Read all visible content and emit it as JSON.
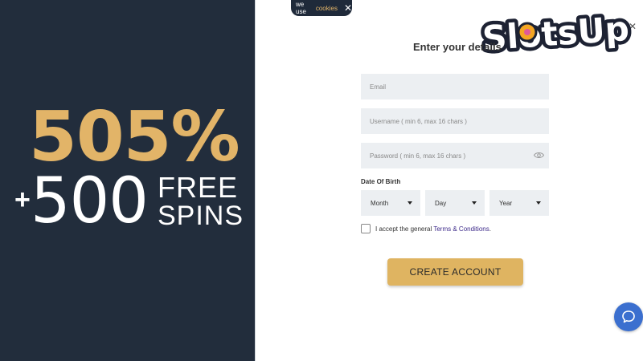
{
  "promo": {
    "percent": "505%",
    "plus": "+",
    "spins_count": "500",
    "free": "FREE",
    "spins": "SPINS"
  },
  "cookie": {
    "text": "we use",
    "link": "cookies"
  },
  "logo": {
    "text": "SlotsUp"
  },
  "form": {
    "title": "Enter your details",
    "email_placeholder": "Email",
    "username_placeholder": "Username ( min 6, max 16 chars )",
    "password_placeholder": "Password ( min 6, max 16 chars )",
    "dob_label": "Date Of Birth",
    "month": "Month",
    "day": "Day",
    "year": "Year",
    "accept_text": "I accept the general",
    "terms_link": "Terms & Conditions",
    "terms_period": ".",
    "create_button": "CREATE ACCOUNT"
  },
  "colors": {
    "panel": "#222d3c",
    "gold": "#e2b468",
    "button": "#dfb461",
    "chat": "#3b6fcf"
  }
}
